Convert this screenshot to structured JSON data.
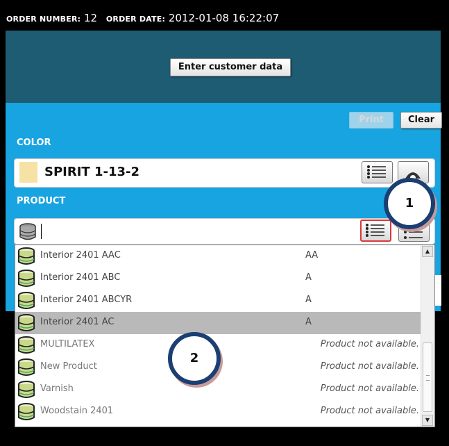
{
  "order_bar": {
    "order_number_label": "ORDER NUMBER:",
    "order_number": "12",
    "order_date_label": "ORDER DATE:",
    "order_date": "2012-01-08 16:22:07"
  },
  "header": {
    "enter_customer_label": "Enter customer data"
  },
  "actions": {
    "print_label": "Print",
    "clear_label": "Clear"
  },
  "color_section": {
    "label": "COLOR",
    "value": "SPIRIT 1-13-2",
    "swatch_color": "#f7e2a5"
  },
  "product_section": {
    "label": "PRODUCT",
    "input_value": ""
  },
  "product_list": {
    "items": [
      {
        "name": "Interior 2401 AAC",
        "grade": "AA",
        "status": ""
      },
      {
        "name": "Interior 2401 ABC",
        "grade": "A",
        "status": ""
      },
      {
        "name": "Interior 2401 ABCYR",
        "grade": "A",
        "status": ""
      },
      {
        "name": "Interior 2401 AC",
        "grade": "A",
        "status": ""
      },
      {
        "name": "MULTILATEX",
        "grade": "",
        "status": "Product not available."
      },
      {
        "name": "New Product",
        "grade": "",
        "status": "Product not available."
      },
      {
        "name": "Varnish",
        "grade": "",
        "status": "Product not available."
      },
      {
        "name": "Woodstain 2401",
        "grade": "",
        "status": "Product not available."
      }
    ],
    "selected_name": "Interior 2401 AC"
  },
  "callouts": {
    "c1": "1",
    "c2": "2"
  },
  "colors": {
    "header_bg": "#1e5c74",
    "main_bg": "#18a4e0",
    "callout_border": "#1b3f73"
  }
}
